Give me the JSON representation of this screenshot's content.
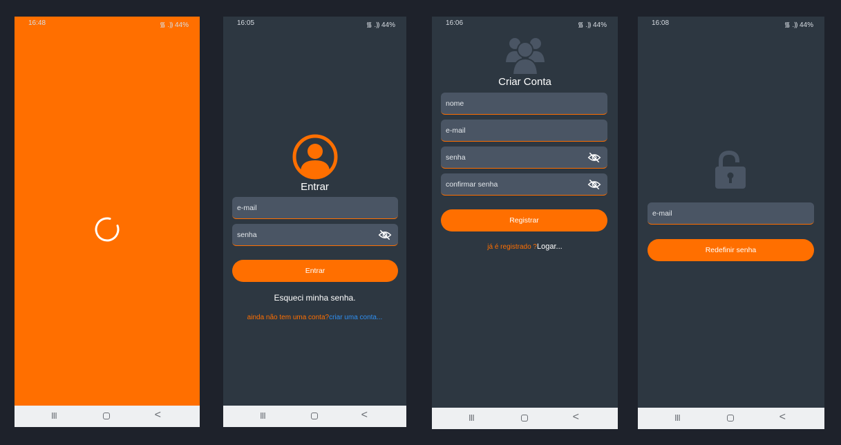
{
  "screens": [
    {
      "status": {
        "time": "16:48",
        "icons": "᯾ .⸩ 44%"
      },
      "background": "#ff6f00"
    },
    {
      "status": {
        "time": "16:05",
        "icons": "᯾ .⸩ 44%"
      },
      "title": "Entrar",
      "email_placeholder": "e-mail",
      "password_placeholder": "senha",
      "button_label": "Entrar",
      "forgot_label": "Esqueci minha senha.",
      "signup_prompt": "ainda não tem uma conta?",
      "signup_link": "criar uma conta..."
    },
    {
      "status": {
        "time": "16:06",
        "icons": "᯾ .⸩ 44%"
      },
      "title": "Criar Conta",
      "name_placeholder": "nome",
      "email_placeholder": "e-mail",
      "password_placeholder": "senha",
      "confirm_placeholder": "confirmar senha",
      "button_label": "Registrar",
      "login_prompt": "já é registrado ?",
      "login_link": "Logar..."
    },
    {
      "status": {
        "time": "16:08",
        "icons": "᯾ .⸩ 44%"
      },
      "email_placeholder": "e-mail",
      "button_label": "Redefinir senha"
    }
  ],
  "navbar": {
    "recent": "III",
    "back": "<"
  },
  "colors": {
    "accent": "#ff6f00",
    "screen_bg": "#2d3741",
    "field_bg": "#4a5564",
    "link_blue": "#2f8ff0",
    "icon_gray": "#4a5564",
    "page_bg": "#1e222b"
  },
  "icons": {
    "status": "wifi-signal-battery",
    "spinner": "loading-spinner-icon",
    "login_avatar": "user-avatar-icon",
    "signup_avatar": "group-users-icon",
    "reset": "unlocked-padlock-icon",
    "eye": "eye-off-icon"
  }
}
